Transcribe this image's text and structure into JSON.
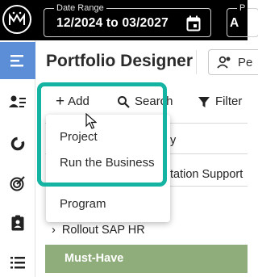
{
  "header": {
    "date_range": {
      "legend": "Date Range",
      "value": "12/2024 to 03/2027"
    },
    "second_field": {
      "legend": "P",
      "value": "A"
    }
  },
  "page": {
    "title": "Portfolio Designer"
  },
  "toolbar": {
    "people_label": "Pe",
    "add_label": "Add",
    "search_label": "Search",
    "filter_label": "Filter"
  },
  "add_menu": {
    "items": [
      "Project",
      "Run the Business",
      "Program"
    ]
  },
  "background": {
    "partial_y": "y",
    "partial_row": "tation Support",
    "row_label": "Rollout SAP HR",
    "group_label": "Must-Have"
  },
  "colors": {
    "accent_teal": "#14b3a2",
    "rail_active": "#5b8ed6",
    "group_row": "#8fad7a"
  }
}
